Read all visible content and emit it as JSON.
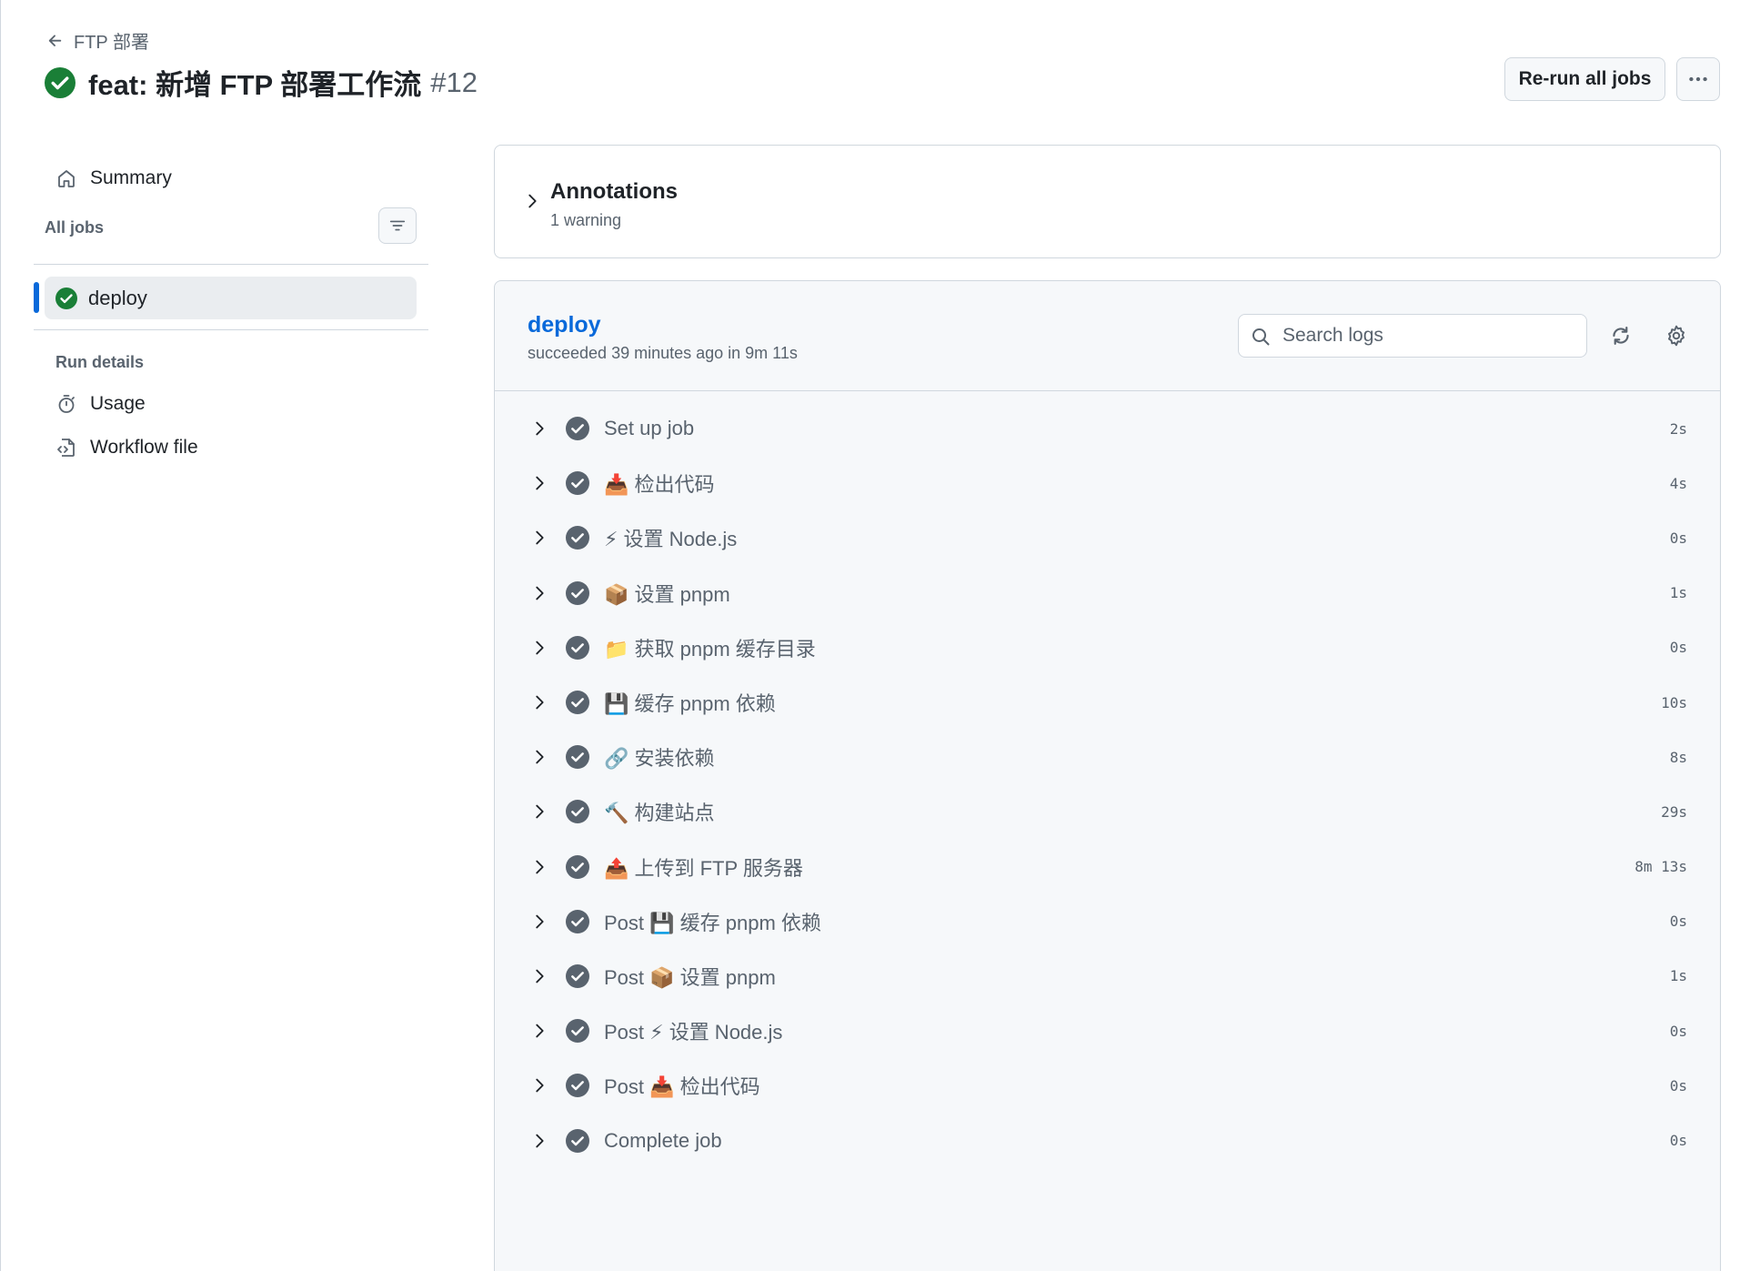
{
  "header": {
    "back_label": "FTP 部署",
    "run_title": "feat: 新增 FTP 部署工作流",
    "run_number": "#12",
    "rerun_label": "Re-run all jobs"
  },
  "sidebar": {
    "summary_label": "Summary",
    "all_jobs_label": "All jobs",
    "job_label": "deploy",
    "run_details_label": "Run details",
    "usage_label": "Usage",
    "workflow_file_label": "Workflow file"
  },
  "annotations": {
    "title": "Annotations",
    "subtitle": "1 warning"
  },
  "job": {
    "name": "deploy",
    "status": "succeeded 39 minutes ago in 9m 11s",
    "search_placeholder": "Search logs",
    "steps": [
      {
        "label": "Set up job",
        "time": "2s"
      },
      {
        "label": "📥 检出代码",
        "time": "4s"
      },
      {
        "label": "⚡ 设置 Node.js",
        "time": "0s"
      },
      {
        "label": "📦 设置 pnpm",
        "time": "1s"
      },
      {
        "label": "📁 获取 pnpm 缓存目录",
        "time": "0s"
      },
      {
        "label": "💾 缓存 pnpm 依赖",
        "time": "10s"
      },
      {
        "label": "🔗 安装依赖",
        "time": "8s"
      },
      {
        "label": "🔨 构建站点",
        "time": "29s"
      },
      {
        "label": "📤 上传到 FTP 服务器",
        "time": "8m 13s"
      },
      {
        "label": "Post 💾 缓存 pnpm 依赖",
        "time": "0s"
      },
      {
        "label": "Post 📦 设置 pnpm",
        "time": "1s"
      },
      {
        "label": "Post ⚡ 设置 Node.js",
        "time": "0s"
      },
      {
        "label": "Post 📥 检出代码",
        "time": "0s"
      },
      {
        "label": "Complete job",
        "time": "0s"
      }
    ]
  },
  "colors": {
    "success": "#1a7f37",
    "accent": "#0969da",
    "step_check": "#59636e"
  }
}
